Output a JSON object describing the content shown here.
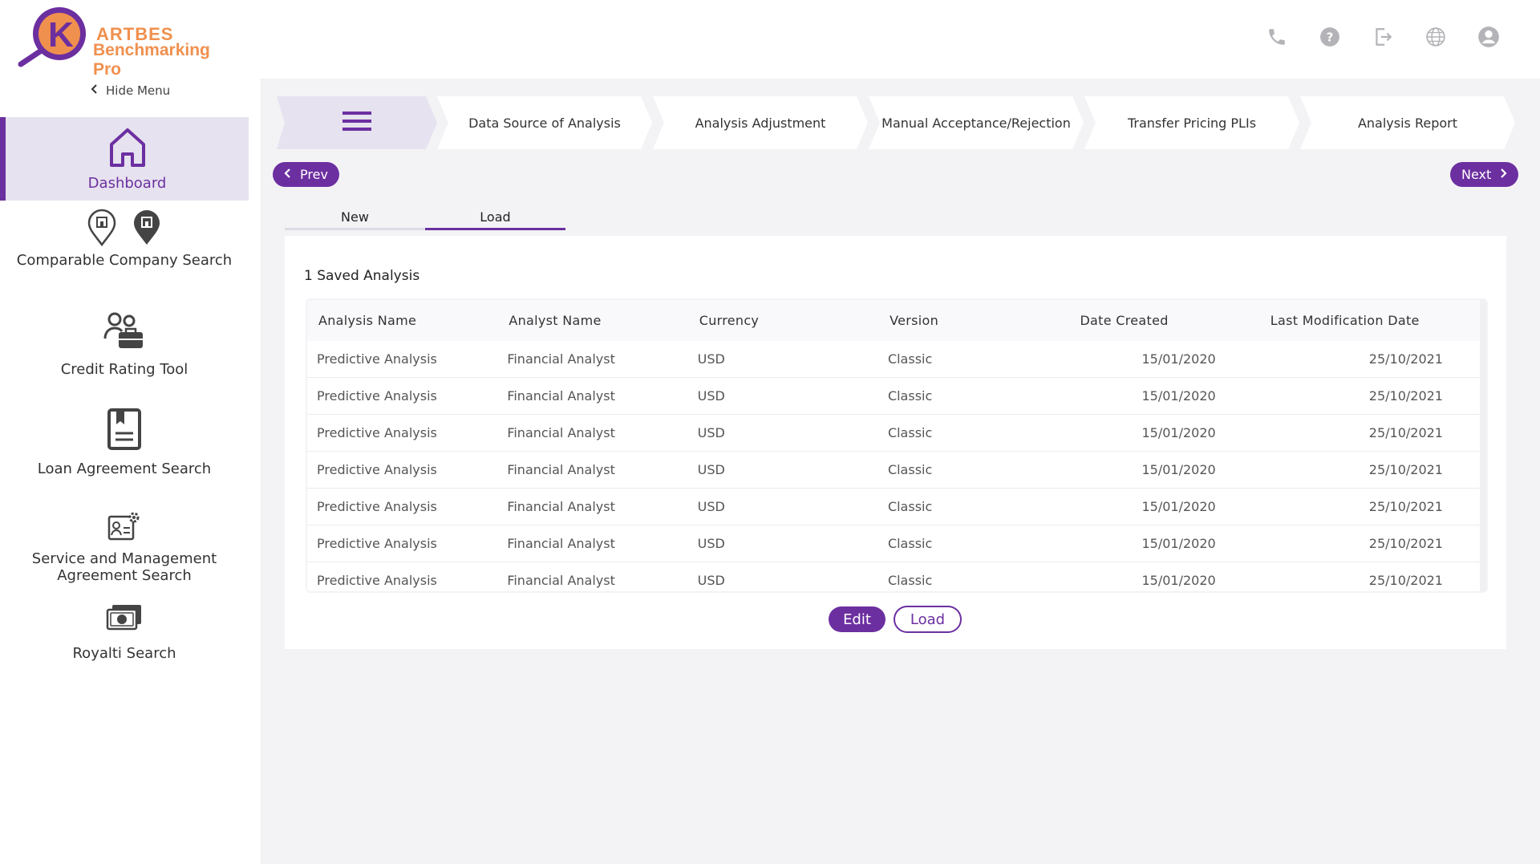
{
  "brand": {
    "line1": "ARTBES",
    "line2": "Benchmarking Pro",
    "accent": "#6c2fa0",
    "logo_color": "#f0904e"
  },
  "header": {
    "icons": [
      "phone-icon",
      "help-icon",
      "logout-icon",
      "globe-icon",
      "user-icon"
    ]
  },
  "sidebar": {
    "hide_menu": "Hide Menu",
    "items": [
      {
        "label": "Dashboard",
        "icon": "home-icon",
        "active": true
      },
      {
        "label": "Comparable Company Search",
        "icon": "map-pin-icon"
      },
      {
        "label": "Credit Rating Tool",
        "icon": "users-briefcase-icon"
      },
      {
        "label": "Loan Agreement Search",
        "icon": "document-bookmark-icon"
      },
      {
        "label": "Service and Management Agreement Search",
        "icon": "id-card-gear-icon"
      },
      {
        "label": "Royalti Search",
        "icon": "money-icon"
      }
    ]
  },
  "steps": [
    "Data Source of Analysis",
    "Analysis Adjustment",
    "Manual Acceptance/Rejection",
    "Transfer Pricing PLIs",
    "Analysis Report"
  ],
  "nav": {
    "prev": "Prev",
    "next": "Next"
  },
  "tabs": {
    "new": "New",
    "load": "Load"
  },
  "card": {
    "title": "1 Saved Analysis",
    "columns": [
      "Analysis Name",
      "Analyst Name",
      "Currency",
      "Version",
      "Date Created",
      "Last Modification Date"
    ],
    "rows": [
      [
        "Predictive Analysis",
        "Financial Analyst",
        "USD",
        "Classic",
        "15/01/2020",
        "25/10/2021"
      ],
      [
        "Predictive Analysis",
        "Financial Analyst",
        "USD",
        "Classic",
        "15/01/2020",
        "25/10/2021"
      ],
      [
        "Predictive Analysis",
        "Financial Analyst",
        "USD",
        "Classic",
        "15/01/2020",
        "25/10/2021"
      ],
      [
        "Predictive Analysis",
        "Financial Analyst",
        "USD",
        "Classic",
        "15/01/2020",
        "25/10/2021"
      ],
      [
        "Predictive Analysis",
        "Financial Analyst",
        "USD",
        "Classic",
        "15/01/2020",
        "25/10/2021"
      ],
      [
        "Predictive Analysis",
        "Financial Analyst",
        "USD",
        "Classic",
        "15/01/2020",
        "25/10/2021"
      ],
      [
        "Predictive Analysis",
        "Financial Analyst",
        "USD",
        "Classic",
        "15/01/2020",
        "25/10/2021"
      ]
    ],
    "edit_label": "Edit",
    "load_label": "Load"
  }
}
